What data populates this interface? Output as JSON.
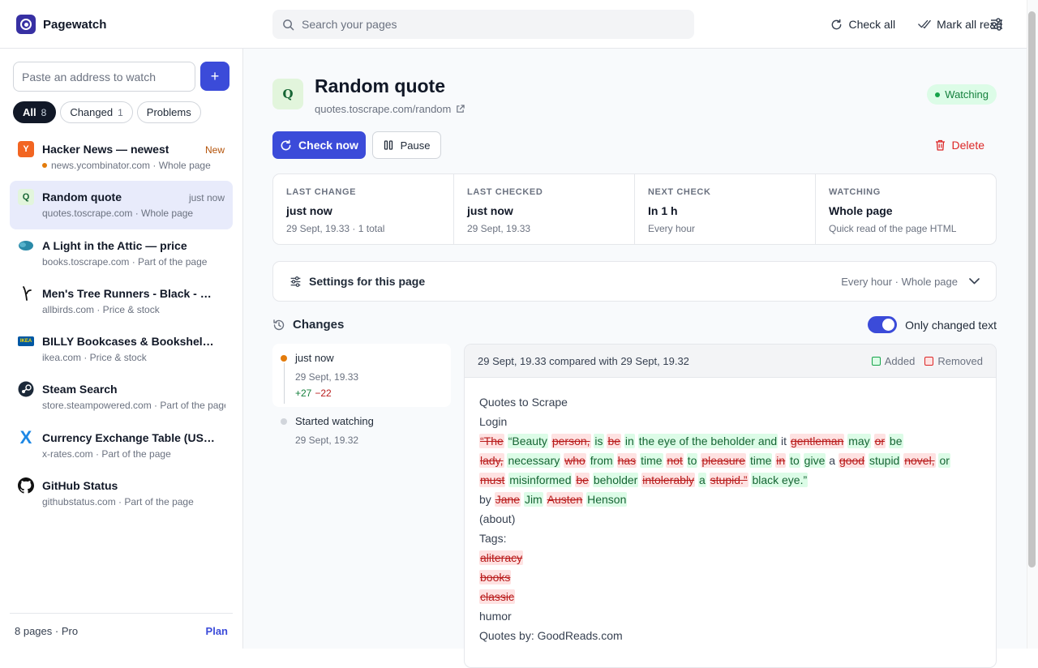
{
  "app": {
    "name": "Pagewatch"
  },
  "topbar": {
    "search_placeholder": "Search your pages",
    "check_all": "Check all",
    "mark_all_read": "Mark all read"
  },
  "sidebar": {
    "address_placeholder": "Paste an address to watch",
    "add_label": "+",
    "filters": [
      {
        "label": "All",
        "count": "8"
      },
      {
        "label": "Changed",
        "count": "1"
      },
      {
        "label": "Problems",
        "count": ""
      }
    ],
    "pages": [
      {
        "title": "Hacker News — newest",
        "sub": "news.ycombinator.com · Whole page",
        "badge": "New",
        "favicon": "Y",
        "fav_bg": "#f26522",
        "fav_fg": "#ffffff",
        "icon": "hacker-news-icon"
      },
      {
        "title": "Random quote",
        "sub": "quotes.toscrape.com · Whole page",
        "badge": "just now",
        "favicon": "Q",
        "fav_bg": "#e2f5dc",
        "fav_fg": "#166534",
        "icon": "quote-icon"
      },
      {
        "title": "A Light in the Attic — price",
        "sub": "books.toscrape.com · Part of the page",
        "badge": "",
        "favicon": "",
        "fav_bg": "transparent",
        "fav_fg": "#000",
        "icon": "books-icon"
      },
      {
        "title": "Men's Tree Runners - Black - Ever...",
        "sub": "allbirds.com · Price & stock",
        "badge": "",
        "favicon": "",
        "fav_bg": "transparent",
        "fav_fg": "#000",
        "icon": "allbirds-icon"
      },
      {
        "title": "BILLY Bookcases & Bookshelves -...",
        "sub": "ikea.com · Price & stock",
        "badge": "",
        "favicon": "IKEA",
        "fav_bg": "#0058a3",
        "fav_fg": "#ffdb00",
        "icon": "ikea-icon"
      },
      {
        "title": "Steam Search",
        "sub": "store.steampowered.com · Part of the page",
        "badge": "",
        "favicon": "",
        "fav_bg": "transparent",
        "fav_fg": "#000",
        "icon": "steam-icon"
      },
      {
        "title": "Currency Exchange Table (US Dol...",
        "sub": "x-rates.com · Part of the page",
        "badge": "",
        "favicon": "X",
        "fav_bg": "transparent",
        "fav_fg": "#1e88e5",
        "icon": "x-rates-icon"
      },
      {
        "title": "GitHub Status",
        "sub": "githubstatus.com · Part of the page",
        "badge": "",
        "favicon": "",
        "fav_bg": "transparent",
        "fav_fg": "#000",
        "icon": "github-icon"
      }
    ],
    "footer": {
      "summary": "8 pages · Pro",
      "plan": "Plan"
    }
  },
  "page": {
    "icon_letter": "Q",
    "title": "Random quote",
    "url": "quotes.toscrape.com/random",
    "status": "Watching",
    "check_now": "Check now",
    "pause": "Pause",
    "delete": "Delete",
    "stats": [
      {
        "label": "LAST CHANGE",
        "value": "just now",
        "sub": "29 Sept, 19.33 · 1 total"
      },
      {
        "label": "LAST CHECKED",
        "value": "just now",
        "sub": "29 Sept, 19.33"
      },
      {
        "label": "NEXT CHECK",
        "value": "In 1 h",
        "sub": "Every hour"
      },
      {
        "label": "WATCHING",
        "value": "Whole page",
        "sub": "Quick read of the page HTML"
      }
    ],
    "settings": {
      "label": "Settings for this page",
      "summary": "Every hour · Whole page"
    }
  },
  "changes": {
    "title": "Changes",
    "toggle_label": "Only changed text",
    "timeline": [
      {
        "title": "just now",
        "date": "29 Sept, 19.33",
        "added": "+27",
        "removed": "−22"
      },
      {
        "title": "Started watching",
        "date": "29 Sept, 19.32",
        "added": "",
        "removed": ""
      }
    ],
    "compare": "29 Sept, 19.33 compared with 29 Sept, 19.32",
    "legend_added": "Added",
    "legend_removed": "Removed",
    "colors": {
      "added": "#16a34a",
      "removed": "#dc2626"
    },
    "diff_lines": [
      [
        {
          "t": "Quotes to Scrape",
          "k": "n"
        }
      ],
      [
        {
          "t": "Login",
          "k": "n"
        }
      ],
      [
        {
          "t": "“The",
          "k": "d"
        },
        {
          "t": " ",
          "k": "n"
        },
        {
          "t": "“Beauty",
          "k": "a"
        },
        {
          "t": " ",
          "k": "n"
        },
        {
          "t": "person,",
          "k": "d"
        },
        {
          "t": " ",
          "k": "n"
        },
        {
          "t": "is",
          "k": "a"
        },
        {
          "t": " ",
          "k": "n"
        },
        {
          "t": "be",
          "k": "d"
        },
        {
          "t": " ",
          "k": "n"
        },
        {
          "t": "in",
          "k": "a"
        },
        {
          "t": " ",
          "k": "n"
        },
        {
          "t": "the eye of the beholder and",
          "k": "a"
        },
        {
          "t": " it ",
          "k": "n"
        },
        {
          "t": "gentleman",
          "k": "d"
        },
        {
          "t": " ",
          "k": "n"
        },
        {
          "t": "may",
          "k": "a"
        },
        {
          "t": " ",
          "k": "n"
        },
        {
          "t": "or",
          "k": "d"
        },
        {
          "t": " ",
          "k": "n"
        },
        {
          "t": "be",
          "k": "a"
        }
      ],
      [
        {
          "t": "lady,",
          "k": "d"
        },
        {
          "t": " ",
          "k": "n"
        },
        {
          "t": "necessary",
          "k": "a"
        },
        {
          "t": " ",
          "k": "n"
        },
        {
          "t": "who",
          "k": "d"
        },
        {
          "t": " ",
          "k": "n"
        },
        {
          "t": "from",
          "k": "a"
        },
        {
          "t": " ",
          "k": "n"
        },
        {
          "t": "has",
          "k": "d"
        },
        {
          "t": " ",
          "k": "n"
        },
        {
          "t": "time",
          "k": "a"
        },
        {
          "t": " ",
          "k": "n"
        },
        {
          "t": "not",
          "k": "d"
        },
        {
          "t": " ",
          "k": "n"
        },
        {
          "t": "to",
          "k": "a"
        },
        {
          "t": " ",
          "k": "n"
        },
        {
          "t": "pleasure",
          "k": "d"
        },
        {
          "t": " ",
          "k": "n"
        },
        {
          "t": "time",
          "k": "a"
        },
        {
          "t": " ",
          "k": "n"
        },
        {
          "t": "in",
          "k": "d"
        },
        {
          "t": " ",
          "k": "n"
        },
        {
          "t": "to",
          "k": "a"
        },
        {
          "t": " ",
          "k": "n"
        },
        {
          "t": "give",
          "k": "a"
        },
        {
          "t": " a ",
          "k": "n"
        },
        {
          "t": "good",
          "k": "d"
        },
        {
          "t": " ",
          "k": "n"
        },
        {
          "t": "stupid",
          "k": "a"
        },
        {
          "t": " ",
          "k": "n"
        },
        {
          "t": "novel,",
          "k": "d"
        },
        {
          "t": " ",
          "k": "n"
        },
        {
          "t": "or",
          "k": "a"
        }
      ],
      [
        {
          "t": "must",
          "k": "d"
        },
        {
          "t": " ",
          "k": "n"
        },
        {
          "t": "misinformed",
          "k": "a"
        },
        {
          "t": " ",
          "k": "n"
        },
        {
          "t": "be",
          "k": "d"
        },
        {
          "t": " ",
          "k": "n"
        },
        {
          "t": "beholder",
          "k": "a"
        },
        {
          "t": " ",
          "k": "n"
        },
        {
          "t": "intolerably",
          "k": "d"
        },
        {
          "t": " ",
          "k": "n"
        },
        {
          "t": "a",
          "k": "a"
        },
        {
          "t": " ",
          "k": "n"
        },
        {
          "t": "stupid.”",
          "k": "d"
        },
        {
          "t": " ",
          "k": "n"
        },
        {
          "t": "black eye.”",
          "k": "a"
        }
      ],
      [
        {
          "t": "by ",
          "k": "n"
        },
        {
          "t": "Jane",
          "k": "d"
        },
        {
          "t": " ",
          "k": "n"
        },
        {
          "t": "Jim",
          "k": "a"
        },
        {
          "t": " ",
          "k": "n"
        },
        {
          "t": "Austen",
          "k": "d"
        },
        {
          "t": " ",
          "k": "n"
        },
        {
          "t": "Henson",
          "k": "a"
        }
      ],
      [
        {
          "t": "(about)",
          "k": "n"
        }
      ],
      [
        {
          "t": "Tags:",
          "k": "n"
        }
      ],
      [
        {
          "t": "aliteracy",
          "k": "d"
        }
      ],
      [
        {
          "t": "books",
          "k": "d"
        }
      ],
      [
        {
          "t": "classic",
          "k": "d"
        }
      ],
      [
        {
          "t": "humor",
          "k": "n"
        }
      ],
      [
        {
          "t": "Quotes by: GoodReads.com",
          "k": "n"
        }
      ]
    ]
  }
}
